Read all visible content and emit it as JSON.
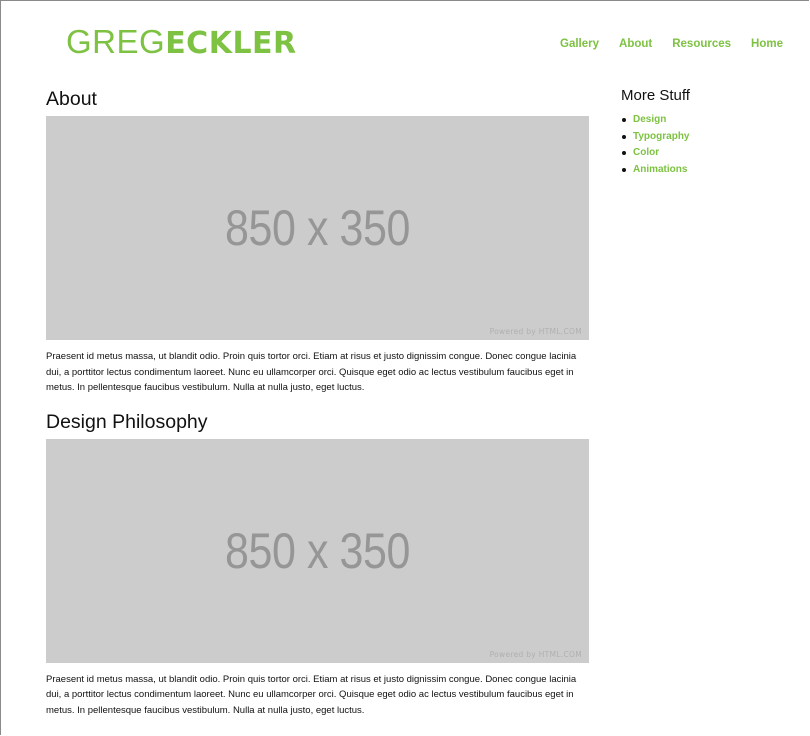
{
  "colors": {
    "accent": "#7dc242",
    "placeholder_bg": "#cccccc",
    "placeholder_text": "#969696",
    "placeholder_credit": "#b0b0b0"
  },
  "header": {
    "logo_light": "GREG",
    "logo_bold": "ECKLER",
    "nav": [
      {
        "label": "Gallery"
      },
      {
        "label": "About"
      },
      {
        "label": "Resources"
      },
      {
        "label": "Home"
      }
    ]
  },
  "main": {
    "sections": [
      {
        "title": "About",
        "image": {
          "dimensions_label": "850 x 350",
          "credit": "Powered by HTML.COM"
        },
        "text": "Praesent id metus massa, ut blandit odio. Proin quis tortor orci. Etiam at risus et justo dignissim congue. Donec congue lacinia dui, a porttitor lectus condimentum laoreet. Nunc eu ullamcorper orci. Quisque eget odio ac lectus vestibulum faucibus eget in metus. In pellentesque faucibus vestibulum. Nulla at nulla justo, eget luctus."
      },
      {
        "title": "Design Philosophy",
        "image": {
          "dimensions_label": "850 x 350",
          "credit": "Powered by HTML.COM"
        },
        "text": "Praesent id metus massa, ut blandit odio. Proin quis tortor orci. Etiam at risus et justo dignissim congue. Donec congue lacinia dui, a porttitor lectus condimentum laoreet. Nunc eu ullamcorper orci. Quisque eget odio ac lectus vestibulum faucibus eget in metus. In pellentesque faucibus vestibulum. Nulla at nulla justo, eget luctus."
      }
    ]
  },
  "sidebar": {
    "title": "More Stuff",
    "items": [
      {
        "label": "Design"
      },
      {
        "label": "Typography"
      },
      {
        "label": "Color"
      },
      {
        "label": "Animations"
      }
    ]
  }
}
